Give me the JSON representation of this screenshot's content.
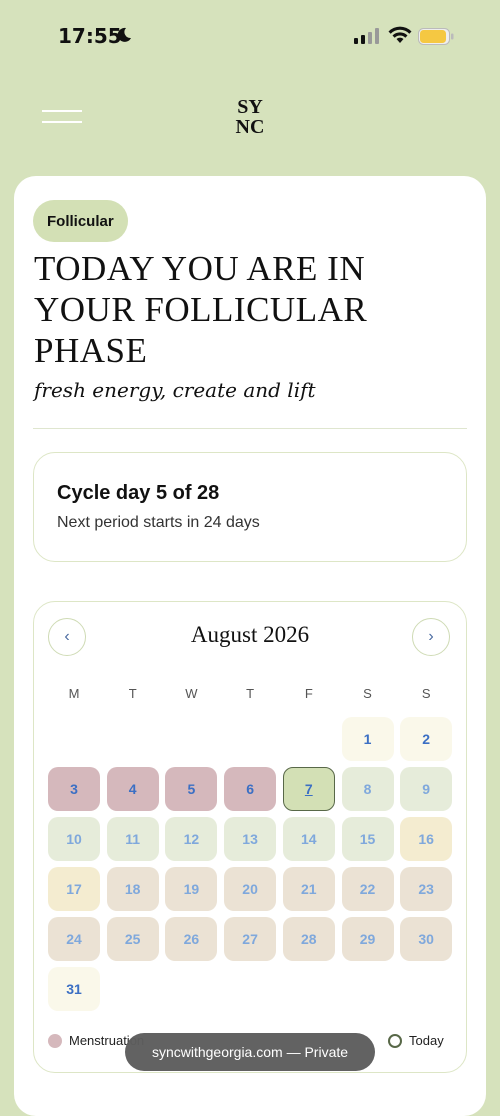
{
  "status_bar": {
    "time": "17:55"
  },
  "header": {
    "logo_text_top": "SY",
    "logo_text_bottom": "NC"
  },
  "phase": {
    "badge": "Follicular",
    "headline": "TODAY YOU ARE IN YOUR FOLLICULAR PHASE",
    "tagline": "fresh energy, create and lift"
  },
  "cycle": {
    "title": "Cycle day 5 of 28",
    "subtitle": "Next period starts in 24 days"
  },
  "calendar": {
    "prev_label": "‹",
    "next_label": "›",
    "month": "August 2026",
    "weekdays": [
      "M",
      "T",
      "W",
      "T",
      "F",
      "S",
      "S"
    ],
    "first_weekday_index": 5,
    "days": [
      {
        "n": "1",
        "phase": "neutral"
      },
      {
        "n": "2",
        "phase": "neutral"
      },
      {
        "n": "3",
        "phase": "menstruation"
      },
      {
        "n": "4",
        "phase": "menstruation"
      },
      {
        "n": "5",
        "phase": "menstruation"
      },
      {
        "n": "6",
        "phase": "menstruation"
      },
      {
        "n": "7",
        "phase": "today"
      },
      {
        "n": "8",
        "phase": "follicular"
      },
      {
        "n": "9",
        "phase": "follicular"
      },
      {
        "n": "10",
        "phase": "follicular"
      },
      {
        "n": "11",
        "phase": "follicular"
      },
      {
        "n": "12",
        "phase": "follicular"
      },
      {
        "n": "13",
        "phase": "follicular"
      },
      {
        "n": "14",
        "phase": "follicular"
      },
      {
        "n": "15",
        "phase": "follicular"
      },
      {
        "n": "16",
        "phase": "ovulation"
      },
      {
        "n": "17",
        "phase": "ovulation"
      },
      {
        "n": "18",
        "phase": "luteal"
      },
      {
        "n": "19",
        "phase": "luteal"
      },
      {
        "n": "20",
        "phase": "luteal"
      },
      {
        "n": "21",
        "phase": "luteal"
      },
      {
        "n": "22",
        "phase": "luteal"
      },
      {
        "n": "23",
        "phase": "luteal"
      },
      {
        "n": "24",
        "phase": "luteal"
      },
      {
        "n": "25",
        "phase": "luteal"
      },
      {
        "n": "26",
        "phase": "luteal"
      },
      {
        "n": "27",
        "phase": "luteal"
      },
      {
        "n": "28",
        "phase": "luteal"
      },
      {
        "n": "29",
        "phase": "luteal"
      },
      {
        "n": "30",
        "phase": "luteal"
      },
      {
        "n": "31",
        "phase": "neutral"
      }
    ]
  },
  "legend": {
    "menstruation": "Menstruation",
    "today": "Today"
  },
  "browser": {
    "url_label": "syncwithgeorgia.com — Private"
  },
  "colors": {
    "background": "#d6e2bc",
    "menstruation": "#d5b8bc",
    "follicular": "#e6ecda",
    "ovulation": "#f4ecd0",
    "luteal": "#ebe2d4",
    "today_ring": "#586848",
    "day_number": "#3b6fc4"
  }
}
